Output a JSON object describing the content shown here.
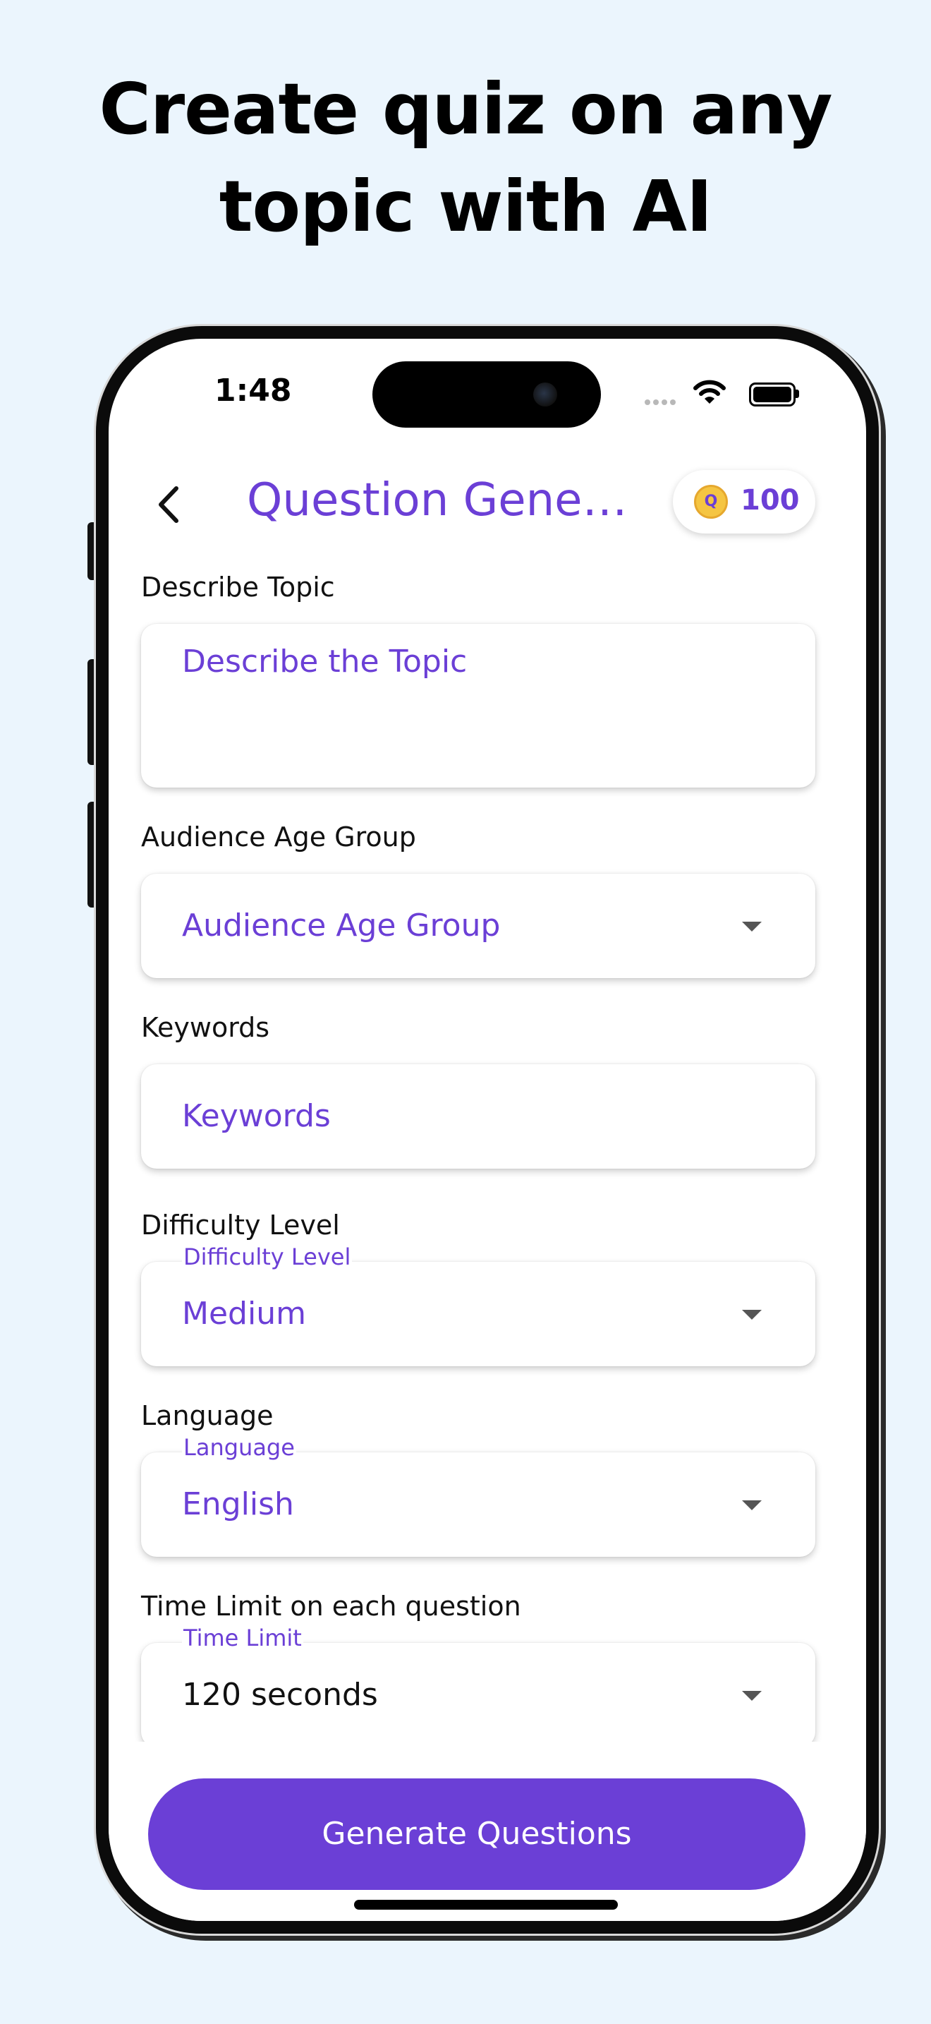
{
  "headline": [
    "Create quiz on any",
    "topic with AI"
  ],
  "status_bar": {
    "time": "1:48"
  },
  "header": {
    "title": "Question Gener…",
    "coins": "100",
    "coin_glyph": "Q"
  },
  "form": {
    "topic": {
      "label": "Describe Topic",
      "placeholder": "Describe the Topic"
    },
    "age_group": {
      "label": "Audience Age Group",
      "placeholder": "Audience Age Group"
    },
    "keywords": {
      "label": "Keywords",
      "placeholder": "Keywords"
    },
    "difficulty": {
      "label": "Difficulty Level",
      "floating_label": "Difficulty Level",
      "value": "Medium"
    },
    "language": {
      "label": "Language",
      "floating_label": "Language",
      "value": "English"
    },
    "time_limit": {
      "label": "Time Limit on each question",
      "floating_label": "Time Limit",
      "value": "120 seconds"
    }
  },
  "actions": {
    "generate_label": "Generate Questions"
  },
  "colors": {
    "accent": "#6B3FD6",
    "background": "#EBF5FD",
    "coin": "#F5C542"
  },
  "icons": {
    "back": "chevron-left-icon",
    "dropdown": "caret-down-icon",
    "coin": "coin-icon",
    "wifi": "wifi-icon",
    "battery": "battery-icon",
    "signal": "signal-icon"
  }
}
